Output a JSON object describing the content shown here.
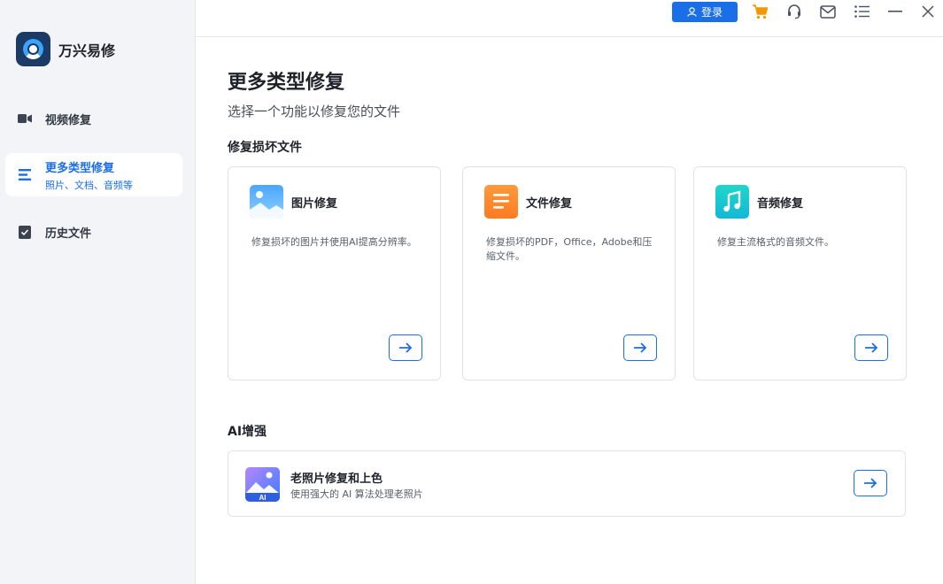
{
  "app": {
    "name": "万兴易修"
  },
  "sidebar": {
    "items": [
      {
        "label": "视频修复",
        "icon": "video-icon"
      },
      {
        "label": "更多类型修复",
        "sub": "照片、文档、音频等",
        "icon": "list-icon",
        "active": true
      },
      {
        "label": "历史文件",
        "icon": "history-file-icon"
      }
    ]
  },
  "topbar": {
    "login_label": "登录",
    "icons": [
      "cart-icon",
      "headset-icon",
      "mail-icon",
      "menu-icon",
      "minimize-icon",
      "close-icon"
    ]
  },
  "main": {
    "title": "更多类型修复",
    "subtitle": "选择一个功能以修复您的文件",
    "section1": "修复损坏文件",
    "cards": [
      {
        "title": "图片修复",
        "desc": "修复损坏的图片并使用AI提高分辨率。",
        "icon": "image-repair-icon"
      },
      {
        "title": "文件修复",
        "desc": "修复损坏的PDF，Office，Adobe和压缩文件。",
        "icon": "document-repair-icon"
      },
      {
        "title": "音频修复",
        "desc": "修复主流格式的音频文件。",
        "icon": "audio-repair-icon"
      }
    ],
    "section2": "AI增强",
    "ai_feature": {
      "title": "老照片修复和上色",
      "desc": "使用强大的 AI 算法处理老照片",
      "badge": "AI",
      "icon": "ai-photo-icon"
    }
  },
  "colors": {
    "accent": "#1a6ee8",
    "sidebar_bg": "#f2f4f8",
    "cart": "#f39800"
  }
}
